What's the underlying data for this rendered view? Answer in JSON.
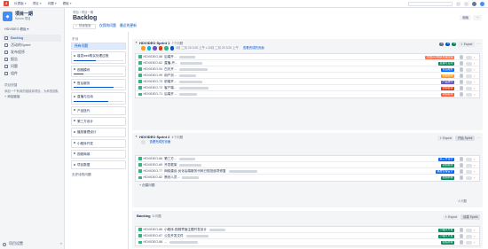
{
  "topbar": {
    "nav": [
      "仪表板",
      "项目",
      "问题",
      "看板"
    ],
    "logo_text": "J"
  },
  "sidebar": {
    "project_name": "项目一期",
    "project_type": "Scrum 项目",
    "board_select": "HDVIDEO 看板",
    "items": [
      {
        "label": "Backlog",
        "active": true
      },
      {
        "label": "活动的Sprint"
      },
      {
        "label": "发布程序"
      },
      {
        "label": "报告"
      },
      {
        "label": "问题"
      },
      {
        "label": "组件"
      }
    ],
    "section_label": "项目快捷",
    "section_text": "添加一个有用的链接到项目，为你的团队",
    "add_link": "+ 添加链接",
    "settings": "项目设置",
    "collapse": "«"
  },
  "main": {
    "breadcrumb": "项目 / 项目一期",
    "title": "Backlog",
    "header_buttons": [
      "面板",
      "⋯"
    ],
    "search_placeholder": "快速搜索",
    "filter_links": [
      "仅我的问题",
      "最近的更新"
    ]
  },
  "epics": {
    "title": "史诗",
    "all": "所有问题",
    "items": [
      {
        "name": "增发web购买处理过程",
        "progress": 0.45
      },
      {
        "name": "视频模块",
        "progress": 0.2
      },
      {
        "name": "售后服务",
        "progress": 0.8
      },
      {
        "name": "直播与互动",
        "progress": 0.7
      },
      {
        "name": "产品迭代",
        "progress": 0
      },
      {
        "name": "第三方设计",
        "progress": 0
      },
      {
        "name": "播放管理设计",
        "progress": 0
      },
      {
        "name": "小程序开发",
        "progress": 0
      },
      {
        "name": "视频商城",
        "progress": 0
      },
      {
        "name": "项目数据",
        "progress": 0
      }
    ],
    "no_epic": "无史诗的问题"
  },
  "sprint1": {
    "name": "HDVIDEO Sprint 1",
    "count": "7个问题",
    "dates": "4月 二月 20 3:20 上午 • 10月 二月 20 3:20 上午",
    "link": "查看完成的页面",
    "pills": [
      "1",
      "0",
      "0"
    ],
    "export": "Export",
    "issues": [
      {
        "key": "HDVIDEO-58",
        "summary": "后端开...",
        "epic": "增发web购买处理过程",
        "epic_color": "#ff7452"
      },
      {
        "key": "HDVIDEO-62",
        "summary": "直播-开...",
        "epic": "直播与互动",
        "epic_color": "#00875a"
      },
      {
        "key": "HDVIDEO-94",
        "summary": "白天开...",
        "epic": "售后服务",
        "epic_color": "#0065ff"
      },
      {
        "key": "HDVIDEO-99",
        "summary": "用户页...",
        "epic": "视频模块",
        "epic_color": "#ff991f"
      },
      {
        "key": "HDVIDEO-73",
        "summary": "前端开...",
        "epic": "产品迭代",
        "epic_color": "#6554c0"
      },
      {
        "key": "HDVIDEO-72",
        "summary": "客户端...",
        "epic": "视频模块",
        "epic_color": "#de350b"
      },
      {
        "key": "HDVIDEO-71",
        "summary": "后端开...",
        "epic": "视频模块",
        "epic_color": "#ff5630"
      }
    ]
  },
  "sprint2": {
    "name": "HDVIDEO Sprint 2",
    "count": "4个问题",
    "link": "查看完成的页面",
    "export": "Export",
    "start": "开始 Sprint",
    "issues": [
      {
        "key": "HDVIDEO-66",
        "summary": "第三方...",
        "epic": "第三方设计",
        "epic_color": "#0065ff"
      },
      {
        "key": "HDVIDEO-69",
        "summary": "开发框架",
        "epic": "视频模块",
        "epic_color": "#00875a"
      },
      {
        "key": "HDVIDEO-77",
        "summary": "网络建设-优化后端服务代码已规范逐项修复",
        "epic": "播放管理设计",
        "epic_color": "#0065ff"
      },
      {
        "key": "HDVIDEO-82",
        "summary": "策划人员...",
        "epic": "视频商城",
        "epic_color": "#00875a"
      }
    ],
    "create": "+ 创建问题",
    "footer_count": "4 问题"
  },
  "backlog": {
    "name": "Backlog",
    "count": "6 问题",
    "export": "Export",
    "create_sprint": "创建 Sprint",
    "issues": [
      {
        "key": "HDVIDEO-86",
        "summary": "小程序-视频界面主题开发设计",
        "epic": "小程序开发",
        "epic_color": "#00875a"
      },
      {
        "key": "HDVIDEO-87",
        "summary": "公告开发文件",
        "epic": "小程序开发",
        "epic_color": "#00875a"
      },
      {
        "key": "HDVIDEO-88",
        "summary": "...",
        "epic": "视频商城",
        "epic_color": "#00875a"
      }
    ]
  }
}
